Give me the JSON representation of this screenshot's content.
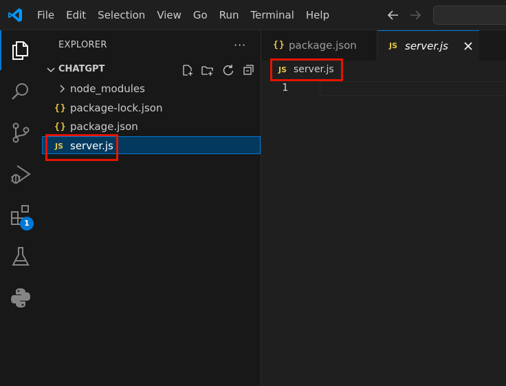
{
  "menu": [
    "File",
    "Edit",
    "Selection",
    "View",
    "Go",
    "Run",
    "Terminal",
    "Help"
  ],
  "activity_bar": {
    "items": [
      "explorer-icon",
      "search-icon",
      "source-control-icon",
      "run-debug-icon",
      "extensions-icon",
      "testing-icon",
      "python-icon"
    ],
    "extensions_badge": "1",
    "accent": "#0078d4"
  },
  "explorer": {
    "title": "EXPLORER",
    "more_actions": "···",
    "folder": "CHATGPT",
    "items": [
      {
        "label": "node_modules",
        "type": "folder"
      },
      {
        "label": "package-lock.json",
        "type": "json",
        "glyph": "{}"
      },
      {
        "label": "package.json",
        "type": "json",
        "glyph": "{}"
      },
      {
        "label": "server.js",
        "type": "js",
        "glyph": "JS",
        "selected": true
      }
    ]
  },
  "tabs": [
    {
      "label": "package.json",
      "glyph": "{}",
      "active": false
    },
    {
      "label": "server.js",
      "glyph": "JS",
      "active": true
    }
  ],
  "breadcrumb": {
    "glyph": "JS",
    "label": "server.js"
  },
  "editor": {
    "line_numbers": [
      "1"
    ]
  },
  "colors": {
    "highlight": "#e51400",
    "json_icon": "#e8c547",
    "selection": "#04395e"
  }
}
